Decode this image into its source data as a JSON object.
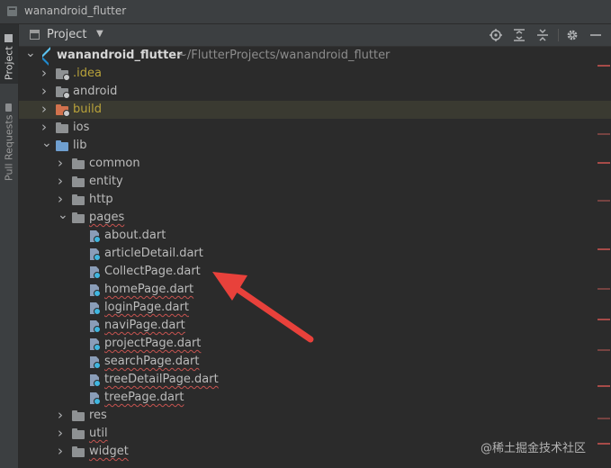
{
  "window": {
    "title": "wanandroid_flutter"
  },
  "side_tabs": [
    "Project",
    "Pull Requests"
  ],
  "toolbar": {
    "label": "Project",
    "dropdown_glyph": "▼"
  },
  "tree": [
    {
      "label": "wanandroid_flutter",
      "path": "~/FlutterProjects/wanandroid_flutter",
      "indent": 0,
      "arrow": "down",
      "icon": "flutter",
      "style": "bold"
    },
    {
      "label": ".idea",
      "indent": 1,
      "arrow": "right",
      "icon": "folder-badge",
      "style": "excluded"
    },
    {
      "label": "android",
      "indent": 1,
      "arrow": "right",
      "icon": "folder-badge",
      "style": "normal"
    },
    {
      "label": "build",
      "indent": 1,
      "arrow": "right",
      "icon": "folder-orange",
      "style": "excluded",
      "highlight": true
    },
    {
      "label": "ios",
      "indent": 1,
      "arrow": "right",
      "icon": "folder",
      "style": "normal"
    },
    {
      "label": "lib",
      "indent": 1,
      "arrow": "down",
      "icon": "folder-blue",
      "style": "normal"
    },
    {
      "label": "common",
      "indent": 2,
      "arrow": "right",
      "icon": "folder",
      "style": "normal"
    },
    {
      "label": "entity",
      "indent": 2,
      "arrow": "right",
      "icon": "folder",
      "style": "normal"
    },
    {
      "label": "http",
      "indent": 2,
      "arrow": "right",
      "icon": "folder",
      "style": "normal"
    },
    {
      "label": "pages",
      "indent": 2,
      "arrow": "down",
      "icon": "folder",
      "style": "squiggle"
    },
    {
      "label": "about.dart",
      "indent": 3,
      "arrow": "",
      "icon": "dart",
      "style": "normal"
    },
    {
      "label": "articleDetail.dart",
      "indent": 3,
      "arrow": "",
      "icon": "dart",
      "style": "normal"
    },
    {
      "label": "CollectPage.dart",
      "indent": 3,
      "arrow": "",
      "icon": "dart",
      "style": "normal"
    },
    {
      "label": "homePage.dart",
      "indent": 3,
      "arrow": "",
      "icon": "dart",
      "style": "squiggle"
    },
    {
      "label": "loginPage.dart",
      "indent": 3,
      "arrow": "",
      "icon": "dart",
      "style": "squiggle"
    },
    {
      "label": "naviPage.dart",
      "indent": 3,
      "arrow": "",
      "icon": "dart",
      "style": "squiggle"
    },
    {
      "label": "projectPage.dart",
      "indent": 3,
      "arrow": "",
      "icon": "dart",
      "style": "squiggle"
    },
    {
      "label": "searchPage.dart",
      "indent": 3,
      "arrow": "",
      "icon": "dart",
      "style": "squiggle"
    },
    {
      "label": "treeDetailPage.dart",
      "indent": 3,
      "arrow": "",
      "icon": "dart",
      "style": "squiggle"
    },
    {
      "label": "treePage.dart",
      "indent": 3,
      "arrow": "",
      "icon": "dart",
      "style": "squiggle"
    },
    {
      "label": "res",
      "indent": 2,
      "arrow": "right",
      "icon": "folder",
      "style": "normal"
    },
    {
      "label": "util",
      "indent": 2,
      "arrow": "right",
      "icon": "folder",
      "style": "squiggle"
    },
    {
      "label": "widget",
      "indent": 2,
      "arrow": "right",
      "icon": "folder",
      "style": "squiggle"
    }
  ],
  "watermark": "@稀土掘金技术社区",
  "colors": {
    "annotation_arrow": "#e8413b",
    "squiggle": "#c75450",
    "excluded": "#b8a23a"
  }
}
